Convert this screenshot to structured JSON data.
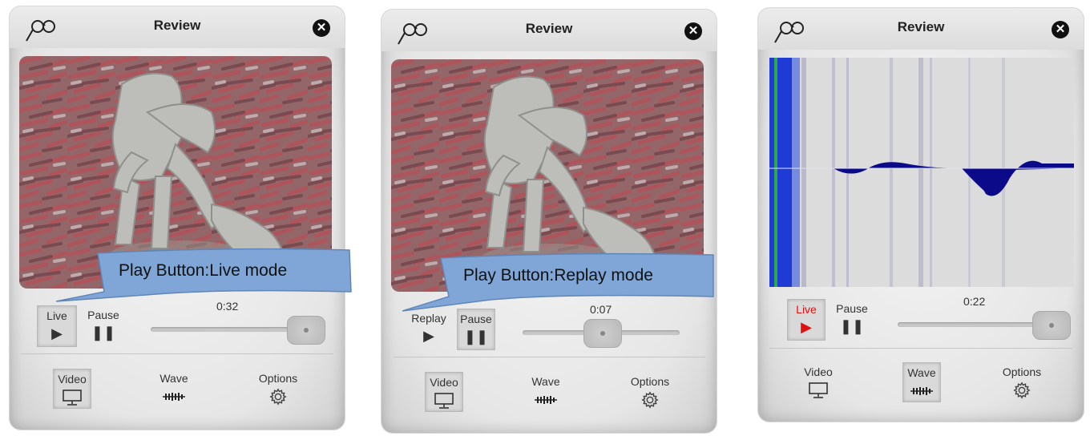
{
  "colors": {
    "live_active": "#e01010",
    "wave_fill": "#0b0b8a",
    "wave_band": "#1f3bd6",
    "callout_fill": "#7fa6d6"
  },
  "panels": [
    {
      "title": "Review",
      "mode_button_label": "Live",
      "pause_label": "Pause",
      "time": "0:32",
      "progress": 1.0,
      "view": "video",
      "callout": "Play Button:Live mode",
      "tabs": {
        "video": "Video",
        "wave": "Wave",
        "options": "Options"
      }
    },
    {
      "title": "Review",
      "mode_button_label": "Replay",
      "pause_label": "Pause",
      "time": "0:07",
      "progress": 0.5,
      "view": "video",
      "callout": "Play Button:Replay mode",
      "tabs": {
        "video": "Video",
        "wave": "Wave",
        "options": "Options"
      }
    },
    {
      "title": "Review",
      "mode_button_label": "Live",
      "pause_label": "Pause",
      "time": "0:22",
      "progress": 1.0,
      "view": "wave",
      "tabs": {
        "video": "Video",
        "wave": "Wave",
        "options": "Options"
      }
    }
  ]
}
